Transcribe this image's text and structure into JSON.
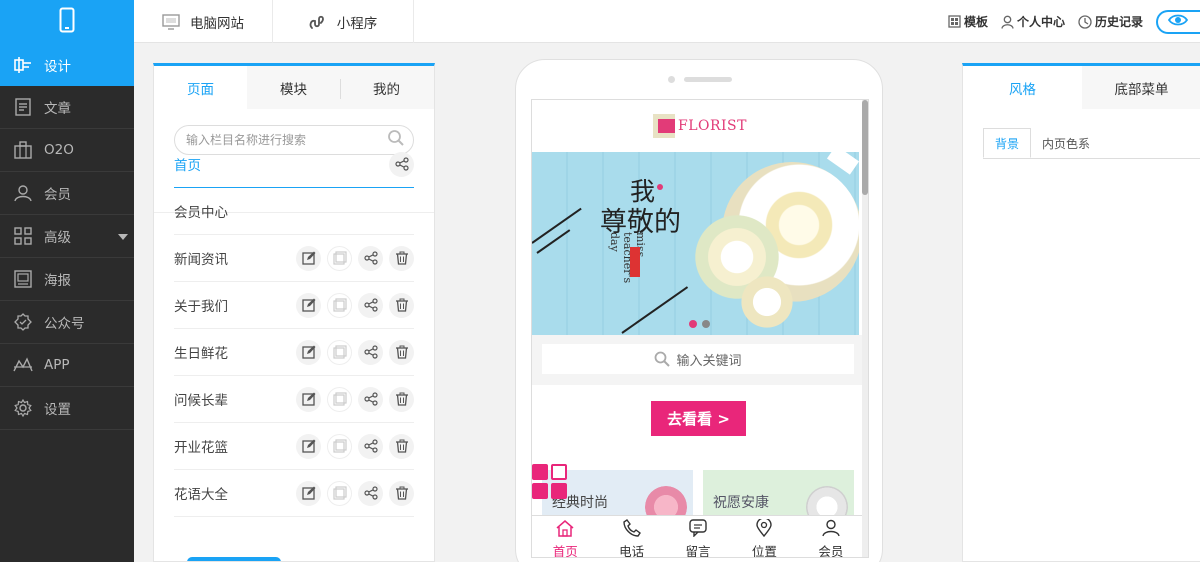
{
  "colors": {
    "accent": "#1aa3f5",
    "sidebar_bg": "#2b2b2b",
    "brand_pink": "#e9267a"
  },
  "sidebar": {
    "logo_icon": "phone-icon",
    "items": [
      {
        "label": "设计",
        "icon": "design-icon",
        "active": true
      },
      {
        "label": "文章",
        "icon": "article-icon"
      },
      {
        "label": "O2O",
        "icon": "o2o-icon"
      },
      {
        "label": "会员",
        "icon": "member-icon"
      },
      {
        "label": "高级",
        "icon": "advanced-icon",
        "has_caret": true
      },
      {
        "label": "海报",
        "icon": "poster-icon"
      },
      {
        "label": "公众号",
        "icon": "wechat-official-icon"
      },
      {
        "label": "APP",
        "icon": "app-icon"
      },
      {
        "label": "设置",
        "icon": "settings-icon"
      }
    ]
  },
  "topbar": {
    "tabs": [
      {
        "label": "电脑网站",
        "icon": "monitor-icon"
      },
      {
        "label": "小程序",
        "icon": "mini-program-icon"
      }
    ],
    "links": [
      {
        "label": "模板",
        "icon": "template-icon"
      },
      {
        "label": "个人中心",
        "icon": "user-icon"
      },
      {
        "label": "历史记录",
        "icon": "history-icon"
      }
    ],
    "preview_icon": "eye-icon"
  },
  "left_panel": {
    "tabs": [
      "页面",
      "模块",
      "我的"
    ],
    "search_placeholder": "输入栏目名称进行搜索",
    "pages": [
      {
        "name": "首页",
        "active": true,
        "actions": [
          "share"
        ]
      },
      {
        "name": "会员中心",
        "actions": []
      },
      {
        "name": "新闻资讯",
        "actions": [
          "edit",
          "copy",
          "share",
          "delete"
        ]
      },
      {
        "name": "关于我们",
        "actions": [
          "edit",
          "copy",
          "share",
          "delete"
        ]
      },
      {
        "name": "生日鲜花",
        "actions": [
          "edit",
          "copy",
          "share",
          "delete"
        ]
      },
      {
        "name": "问候长辈",
        "actions": [
          "edit",
          "copy",
          "share",
          "delete"
        ]
      },
      {
        "name": "开业花篮",
        "actions": [
          "edit",
          "copy",
          "share",
          "delete"
        ]
      },
      {
        "name": "花语大全",
        "actions": [
          "edit",
          "copy",
          "share",
          "delete"
        ]
      }
    ]
  },
  "phone": {
    "logo_text": "FLORIST",
    "banner": {
      "line1": "我",
      "line2": "尊敬的",
      "en_text": "miss teacher's day",
      "slide_count": 2,
      "active_slide": 0
    },
    "search_placeholder": "输入关键词",
    "cta_label": "去看看 >",
    "cards": [
      {
        "label": "经典时尚"
      },
      {
        "label": "祝愿安康"
      }
    ],
    "tabbar": [
      {
        "label": "首页",
        "icon": "home-icon",
        "active": true
      },
      {
        "label": "电话",
        "icon": "phone-call-icon"
      },
      {
        "label": "留言",
        "icon": "message-icon"
      },
      {
        "label": "位置",
        "icon": "location-icon"
      },
      {
        "label": "会员",
        "icon": "member-icon"
      }
    ]
  },
  "right_panel": {
    "tabs": [
      "风格",
      "底部菜单"
    ],
    "sub_tabs": [
      "背景",
      "内页色系"
    ]
  }
}
